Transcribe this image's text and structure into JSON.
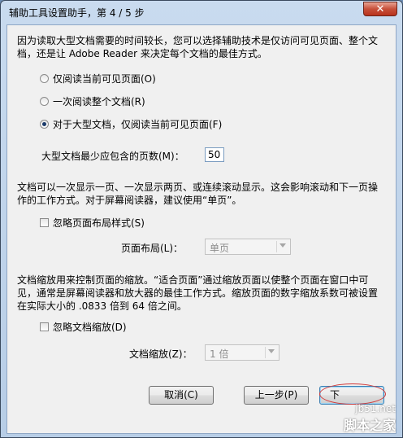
{
  "window": {
    "title": "辅助工具设置助手，第 4 / 5 步",
    "close_label": "✕"
  },
  "intro": {
    "line1": "因为读取大型文档需要的时间较长，您可以选择辅助技术是仅访问可见页面、整个文",
    "line2": "档，还是让 Adobe Reader 来决定每个文档的最佳方式。"
  },
  "read_options": [
    {
      "label": "仅阅读当前可见页面(O)",
      "checked": false
    },
    {
      "label": "一次阅读整个文档(R)",
      "checked": false
    },
    {
      "label": "对于大型文档，仅阅读当前可见页面(F)",
      "checked": true
    }
  ],
  "min_pages": {
    "label": "大型文档最少应包含的页数(M)：",
    "value": "50"
  },
  "layout_section": {
    "line1": "文档可以一次显示一页、一次显示两页、或连续滚动显示。这会影响滚动和下一页操",
    "line2": "作的工作方式。对于屏幕阅读器，建议使用“单页”。",
    "ignore_label": "忽略页面布局样式(S)",
    "ignore_checked": false,
    "layout_label": "页面布局(L)：",
    "layout_value": "单页"
  },
  "zoom_section": {
    "line1": "文档缩放用来控制页面的缩放。“适合页面”通过缩放页面以使整个页面在窗口中可",
    "line2": "见，通常是屏幕阅读器和放大器的最佳工作方式。缩放页面的数字缩放系数可被设置",
    "line3": "在实际大小的 .0833 倍到 64 倍之间。",
    "ignore_label": "忽略文档缩放(D)",
    "ignore_checked": false,
    "zoom_label": "文档缩放(Z)：",
    "zoom_value": "1 倍"
  },
  "buttons": {
    "cancel": "取消(C)",
    "back": "上一步(P)",
    "next": "下"
  },
  "watermark": {
    "site": "jb51.net",
    "brand": "脚本之家"
  }
}
